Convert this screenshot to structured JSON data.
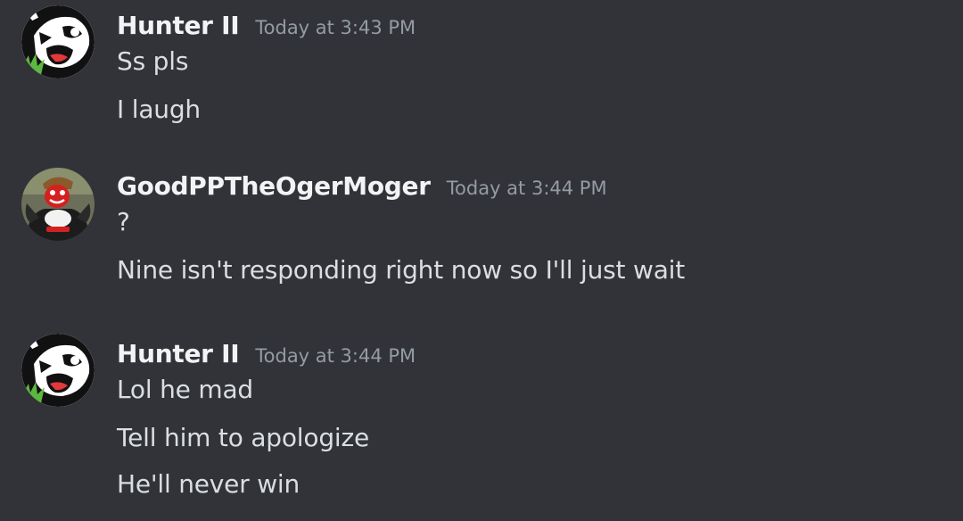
{
  "messages": [
    {
      "author": "Hunter II",
      "avatar_icon": "laughing-face-avatar-icon",
      "timestamp": "Today at 3:43 PM",
      "lines": [
        "Ss pls",
        "I laugh"
      ]
    },
    {
      "author": "GoodPPTheOgerMoger",
      "avatar_icon": "red-character-avatar-icon",
      "timestamp": "Today at 3:44 PM",
      "lines": [
        "?",
        "Nine isn't responding right now so I'll just wait"
      ]
    },
    {
      "author": "Hunter II",
      "avatar_icon": "laughing-face-avatar-icon",
      "timestamp": "Today at 3:44 PM",
      "lines": [
        "Lol he mad",
        "Tell him to apologize",
        "He'll never win"
      ]
    }
  ],
  "colors": {
    "background": "#313338",
    "username": "#f2f3f5",
    "text": "#dbdee1",
    "timestamp": "#949ba4"
  }
}
